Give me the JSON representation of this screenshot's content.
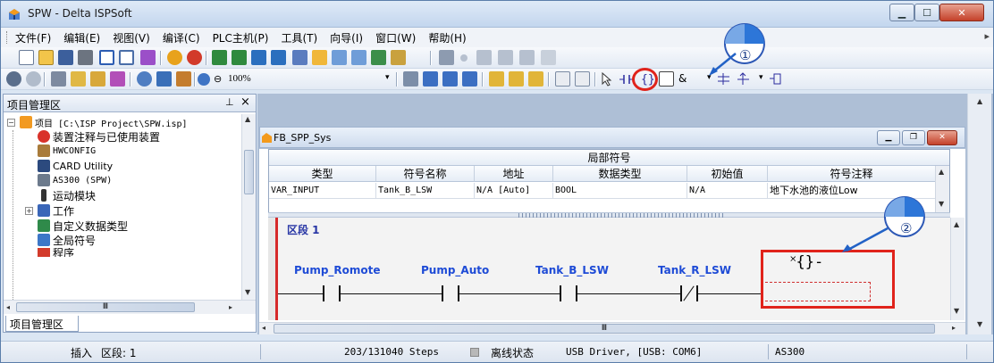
{
  "window": {
    "title": "SPW - Delta ISPSoft"
  },
  "menu": {
    "items": [
      "文件(F)",
      "编辑(E)",
      "视图(V)",
      "编译(C)",
      "PLC主机(P)",
      "工具(T)",
      "向导(I)",
      "窗口(W)",
      "帮助(H)"
    ]
  },
  "toolbar": {
    "zoom_level": "100%",
    "and_label": "&"
  },
  "callouts": {
    "one": "①",
    "two": "②"
  },
  "project_panel": {
    "title": "项目管理区",
    "pin": "ᚁ",
    "close": "×",
    "tab_label": "项目管理区",
    "tree": [
      {
        "label": "项目 [C:\\ISP Project\\SPW.isp]",
        "icon": "project-icon",
        "mono": true
      },
      {
        "label": "装置注释与已使用装置",
        "icon": "device-comment-icon"
      },
      {
        "label": "HWCONFIG",
        "icon": "hwconfig-icon",
        "mono": true
      },
      {
        "label": "CARD Utility",
        "icon": "card-icon"
      },
      {
        "label": "AS300 (SPW)",
        "icon": "plc-icon",
        "mono": true
      },
      {
        "label": "运动模块",
        "icon": "motion-icon"
      },
      {
        "label": "工作",
        "icon": "task-icon"
      },
      {
        "label": "自定义数据类型",
        "icon": "datatype-icon"
      },
      {
        "label": "全局符号",
        "icon": "global-symbol-icon"
      },
      {
        "label": "程序",
        "icon": "program-icon"
      }
    ],
    "scroll_thumb_label": "Ⅲ"
  },
  "editor": {
    "doc_title": "FB_SPP_Sys",
    "local_symbols_title": "局部符号",
    "columns": [
      "类型",
      "符号名称",
      "地址",
      "数据类型",
      "初始值",
      "符号注释"
    ],
    "rows": [
      [
        "VAR_INPUT",
        "Tank_B_LSW",
        "N/A [Auto]",
        "BOOL",
        "N/A",
        "地下水池的液位Low"
      ]
    ],
    "segment_label": "区段 1",
    "contacts": [
      {
        "name": "Pump_Romote",
        "type": "NO"
      },
      {
        "name": "Pump_Auto",
        "type": "NO"
      },
      {
        "name": "Tank_B_LSW",
        "type": "NO"
      },
      {
        "name": "Tank_R_LSW",
        "type": "NC"
      }
    ],
    "coil_symbol": "˟{}-",
    "hscroll_label": "Ⅲ"
  },
  "status": {
    "mode": "插入",
    "segment": "区段: 1",
    "steps": "203/131040 Steps",
    "connection": "离线状态",
    "driver": "USB Driver, [USB: COM6]",
    "model": "AS300"
  },
  "colors": {
    "highlight_red": "#e0231b",
    "rail_red": "#d62a2a",
    "label_blue": "#1e4bd6"
  }
}
